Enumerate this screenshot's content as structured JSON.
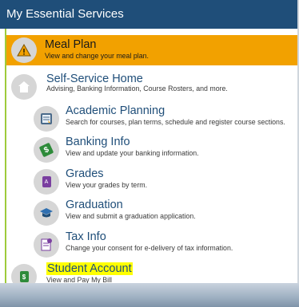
{
  "header": {
    "title": "My Essential Services"
  },
  "items": [
    {
      "title": "Meal Plan",
      "desc": "View and change your meal plan.",
      "icon": "warning-icon"
    },
    {
      "title": "Self-Service Home",
      "desc": "Advising, Banking Information, Course Rosters, and more.",
      "icon": "home-icon"
    },
    {
      "title": "Academic Planning",
      "desc": "Search for courses, plan terms, schedule and register course sections.",
      "icon": "planning-icon"
    },
    {
      "title": "Banking Info",
      "desc": "View and update your banking information.",
      "icon": "banking-icon"
    },
    {
      "title": "Grades",
      "desc": "View your grades by term.",
      "icon": "grades-icon"
    },
    {
      "title": "Graduation",
      "desc": "View and submit a graduation application.",
      "icon": "graduation-cap-icon"
    },
    {
      "title": "Tax Info",
      "desc": "Change your consent for e-delivery of tax information.",
      "icon": "tax-info-icon"
    },
    {
      "title": "Student Account",
      "desc": "View and Pay My Bill",
      "icon": "student-account-icon"
    }
  ],
  "colors": {
    "header_bg": "#1f4e79",
    "meal_bg": "#f2a100",
    "accent_line": "#9ecb3b",
    "highlight": "#ffff00",
    "title_text": "#1f4e79"
  }
}
